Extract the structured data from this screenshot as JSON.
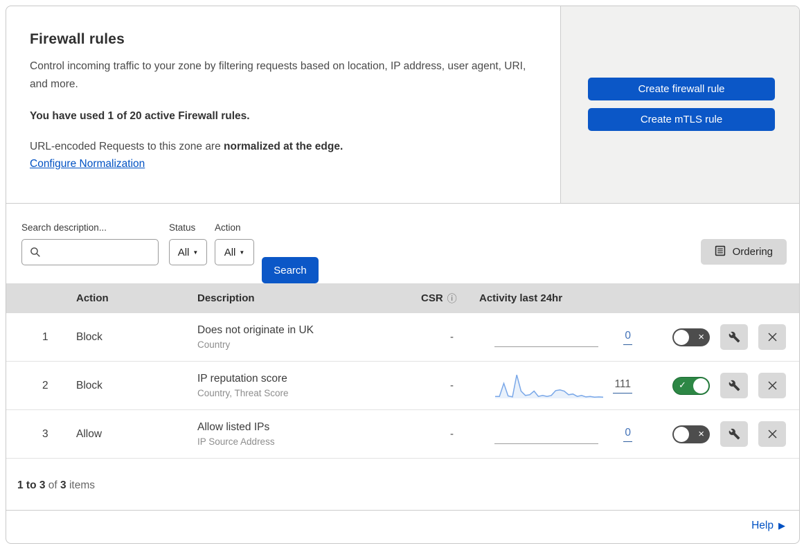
{
  "colors": {
    "accent_blue": "#0b57c7",
    "link_blue": "#0051c3",
    "toggle_on_green": "#2d8745",
    "toggle_off_gray": "#4d4d4d",
    "table_header_bg": "#dcdcdc",
    "side_panel_bg": "#f1f1f0",
    "spark_line": "#79a7e8"
  },
  "header": {
    "title": "Firewall rules",
    "description": "Control incoming traffic to your zone by filtering requests based on location, IP address, user agent, URI, and more.",
    "usage_line": "You have used 1 of 20 active Firewall rules.",
    "normalization_prefix": "URL-encoded Requests to this zone are ",
    "normalization_bold": "normalized at the edge.",
    "normalization_link": "Configure Normalization",
    "create_firewall_button": "Create firewall rule",
    "create_mtls_button": "Create mTLS rule"
  },
  "filters": {
    "search_label": "Search description...",
    "search_value": "",
    "status_label": "Status",
    "status_value": "All",
    "action_label": "Action",
    "action_value": "All",
    "search_button": "Search",
    "ordering_button": "Ordering"
  },
  "table": {
    "columns": {
      "action": "Action",
      "description": "Description",
      "csr": "CSR",
      "csr_info_icon": "ⓘ",
      "activity": "Activity last 24hr"
    },
    "rows": [
      {
        "index": "1",
        "action": "Block",
        "description": "Does not originate in UK",
        "fields": "Country",
        "csr": "-",
        "activity_count": "0",
        "activity_count_color": "#4272b8",
        "enabled": false,
        "sparkline": null
      },
      {
        "index": "2",
        "action": "Block",
        "description": "IP reputation score",
        "fields": "Country, Threat Score",
        "csr": "-",
        "activity_count": "111",
        "activity_count_color": "#555555",
        "enabled": true,
        "sparkline": [
          8,
          8,
          62,
          10,
          6,
          97,
          30,
          12,
          15,
          30,
          8,
          12,
          8,
          12,
          32,
          35,
          30,
          15,
          18,
          8,
          12,
          6,
          8,
          5,
          6,
          5
        ]
      },
      {
        "index": "3",
        "action": "Allow",
        "description": "Allow listed IPs",
        "fields": "IP Source Address",
        "csr": "-",
        "activity_count": "0",
        "activity_count_color": "#4272b8",
        "enabled": false,
        "sparkline": null
      }
    ]
  },
  "pagination": {
    "range_bold": "1 to 3",
    "of_text": "of",
    "total_bold": "3",
    "items_text": "items"
  },
  "footer": {
    "help_label": "Help",
    "help_arrow": "▶"
  }
}
